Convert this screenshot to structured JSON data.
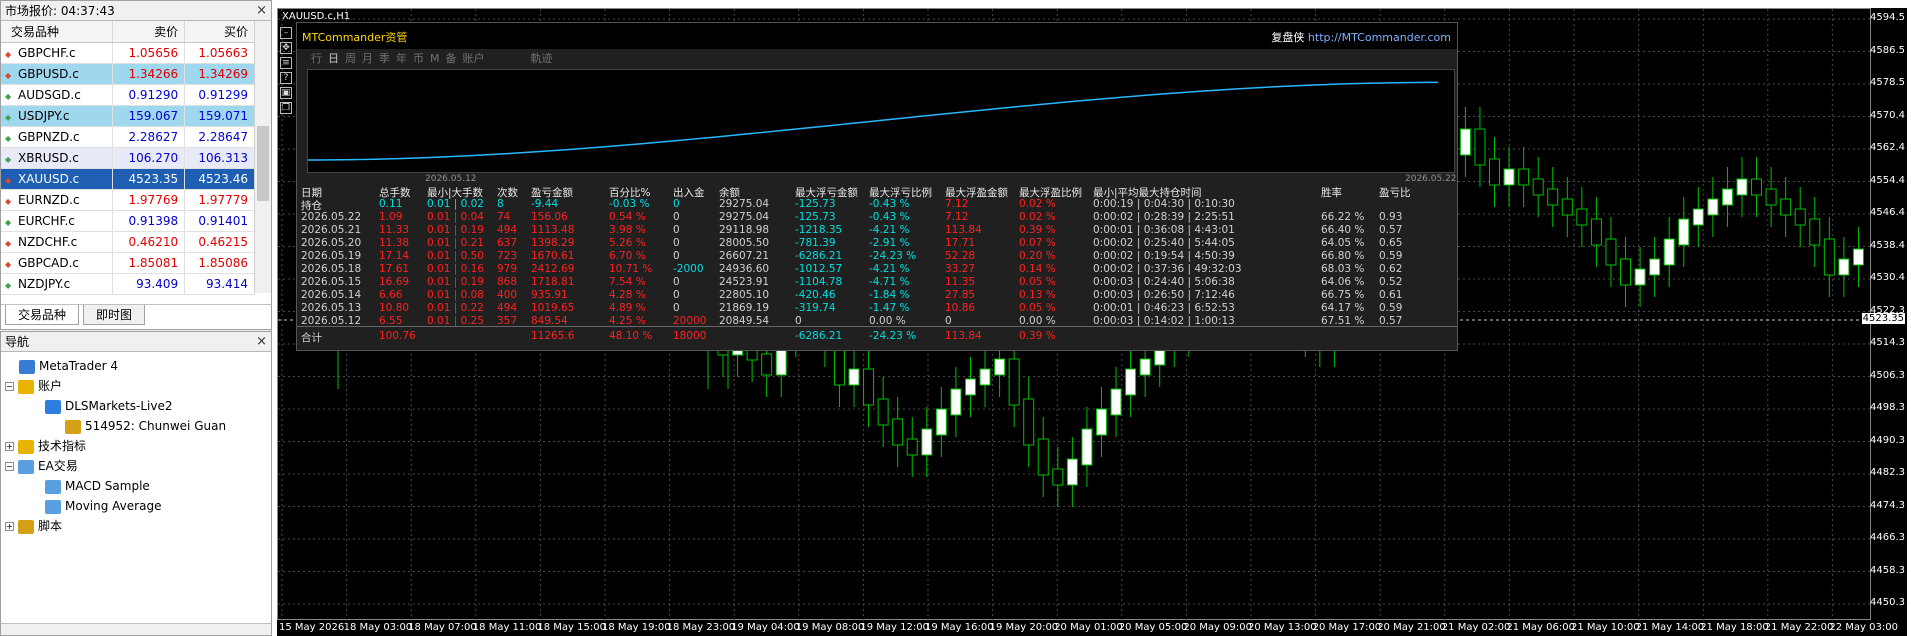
{
  "market_watch": {
    "title": "市场报价: 04:37:43",
    "close": "×",
    "col_symbol": "交易品种",
    "col_bid": "卖价",
    "col_ask": "买价",
    "rows": [
      {
        "symbol": "GBPCHF.c",
        "bid": "1.05656",
        "ask": "1.05663",
        "dir": "down",
        "color": "red"
      },
      {
        "symbol": "GBPUSD.c",
        "bid": "1.34266",
        "ask": "1.34269",
        "dir": "down",
        "color": "red"
      },
      {
        "symbol": "AUDSGD.c",
        "bid": "0.91290",
        "ask": "0.91299",
        "dir": "up",
        "color": "blue"
      },
      {
        "symbol": "USDJPY.c",
        "bid": "159.067",
        "ask": "159.071",
        "dir": "up",
        "color": "blue"
      },
      {
        "symbol": "GBPNZD.c",
        "bid": "2.28627",
        "ask": "2.28647",
        "dir": "up",
        "color": "blue"
      },
      {
        "symbol": "XBRUSD.c",
        "bid": "106.270",
        "ask": "106.313",
        "dir": "up",
        "color": "blue"
      },
      {
        "symbol": "XAUUSD.c",
        "bid": "4523.35",
        "ask": "4523.46",
        "dir": "down",
        "color": "white"
      },
      {
        "symbol": "EURNZD.c",
        "bid": "1.97769",
        "ask": "1.97779",
        "dir": "down",
        "color": "red"
      },
      {
        "symbol": "EURCHF.c",
        "bid": "0.91398",
        "ask": "0.91401",
        "dir": "up",
        "color": "blue"
      },
      {
        "symbol": "NZDCHF.c",
        "bid": "0.46210",
        "ask": "0.46215",
        "dir": "down",
        "color": "red"
      },
      {
        "symbol": "GBPCAD.c",
        "bid": "1.85081",
        "ask": "1.85086",
        "dir": "down",
        "color": "red"
      },
      {
        "symbol": "NZDJPY.c",
        "bid": "93.409",
        "ask": "93.414",
        "dir": "up",
        "color": "blue"
      }
    ],
    "tabs": [
      "交易品种",
      "即时图"
    ]
  },
  "navigator": {
    "title": "导航",
    "close": "×",
    "items": [
      {
        "label": "MetaTrader 4",
        "icon": "terminal-icon",
        "level": 0
      },
      {
        "label": "账户",
        "icon": "accounts-icon",
        "level": 1
      },
      {
        "label": "DLSMarkets-Live2",
        "icon": "server-icon",
        "level": 2
      },
      {
        "label": "514952: Chunwei Guan",
        "icon": "user-icon",
        "level": 3
      },
      {
        "label": "技术指标",
        "icon": "indicator-icon",
        "level": 1
      },
      {
        "label": "EA交易",
        "icon": "expert-icon",
        "level": 1
      },
      {
        "label": "MACD Sample",
        "icon": "expert-icon",
        "level": 2
      },
      {
        "label": "Moving Average",
        "icon": "expert-icon",
        "level": 2
      },
      {
        "label": "脚本",
        "icon": "script-icon",
        "level": 1
      }
    ]
  },
  "chart": {
    "title": "XAUUSD.c,H1",
    "price_labels": [
      "4594.5",
      "4586.5",
      "4578.5",
      "4570.4",
      "4562.4",
      "4554.4",
      "4546.4",
      "4538.4",
      "4530.4",
      "4522.3",
      "4514.3",
      "4506.3",
      "4498.3",
      "4490.3",
      "4482.3",
      "4474.3",
      "4466.3",
      "4458.3",
      "4450.3"
    ],
    "current_price": "4523.35",
    "time_labels": [
      "15 May 2026",
      "18 May 03:00",
      "18 May 07:00",
      "18 May 11:00",
      "18 May 15:00",
      "18 May 19:00",
      "18 May 23:00",
      "19 May 04:00",
      "19 May 08:00",
      "19 May 12:00",
      "19 May 16:00",
      "19 May 20:00",
      "20 May 01:00",
      "20 May 05:00",
      "20 May 09:00",
      "20 May 13:00",
      "20 May 17:00",
      "20 May 21:00",
      "21 May 02:00",
      "21 May 06:00",
      "21 May 10:00",
      "21 May 14:00",
      "21 May 18:00",
      "21 May 22:00",
      "22 May 03:00"
    ],
    "colors": {
      "bull": "#ffffff",
      "bear": "#000000",
      "wick": "#00cc00",
      "bg": "#000000",
      "grid": "#555555"
    }
  },
  "overlay": {
    "brand": "MTCommander资管",
    "link_cn": "复盘侠",
    "link_url": "http://MTCommander.com",
    "tabs": [
      "行",
      "日",
      "周",
      "月",
      "季",
      "年",
      "币",
      "M",
      "备",
      "账户",
      "",
      "軌迹"
    ],
    "curve_start": "2026.05.12",
    "curve_end": "2026.05.22",
    "headers": [
      "日期",
      "总手数",
      "最小|大手数",
      "次数",
      "盈亏金额",
      "百分比%",
      "出入金",
      "余额",
      "最大浮亏金额",
      "最大浮亏比例",
      "最大浮盈金额",
      "最大浮盈比例",
      "最小|平均最大持仓时间",
      "胜率",
      "盈亏比"
    ],
    "position_row": [
      "持仓",
      "0.11",
      "0.01 | 0.02",
      "8",
      "-9.44",
      "-0.03 %",
      "0",
      "29275.04",
      "-125.73",
      "-0.43 %",
      "7.12",
      "0.02 %",
      "0:00:19 | 0:04:30 | 0:10:30",
      "",
      ""
    ],
    "rows": [
      [
        "2026.05.22",
        "1.09",
        "0.01 | 0.04",
        "74",
        "156.06",
        "0.54 %",
        "0",
        "29275.04",
        "-125.73",
        "-0.43 %",
        "7.12",
        "0.02 %",
        "0:00:02 | 0:28:39 | 2:25:51",
        "66.22 %",
        "0.93"
      ],
      [
        "2026.05.21",
        "11.33",
        "0.01 | 0.19",
        "494",
        "1113.48",
        "3.98 %",
        "0",
        "29118.98",
        "-1218.35",
        "-4.21 %",
        "113.84",
        "0.39 %",
        "0:00:01 | 0:36:08 | 4:43:01",
        "66.40 %",
        "0.57"
      ],
      [
        "2026.05.20",
        "11.38",
        "0.01 | 0.21",
        "637",
        "1398.29",
        "5.26 %",
        "0",
        "28005.50",
        "-781.39",
        "-2.91 %",
        "17.71",
        "0.07 %",
        "0:00:02 | 0:25:40 | 5:44:05",
        "64.05 %",
        "0.65"
      ],
      [
        "2026.05.19",
        "17.14",
        "0.01 | 0.50",
        "723",
        "1670.61",
        "6.70 %",
        "0",
        "26607.21",
        "-6286.21",
        "-24.23 %",
        "52.28",
        "0.20 %",
        "0:00:02 | 0:19:54 | 4:50:39",
        "66.80 %",
        "0.59"
      ],
      [
        "2026.05.18",
        "17.61",
        "0.01 | 0.16",
        "979",
        "2412.69",
        "10.71 %",
        "-2000",
        "24936.60",
        "-1012.57",
        "-4.21 %",
        "33.27",
        "0.14 %",
        "0:00:02 | 0:37:36 | 49:32:03",
        "68.03 %",
        "0.62"
      ],
      [
        "2026.05.15",
        "16.69",
        "0.01 | 0.19",
        "868",
        "1718.81",
        "7.54 %",
        "0",
        "24523.91",
        "-1104.78",
        "-4.71 %",
        "11.35",
        "0.05 %",
        "0:00:03 | 0:24:40 | 5:06:38",
        "64.06 %",
        "0.52"
      ],
      [
        "2026.05.14",
        "6.66",
        "0.01 | 0.08",
        "400",
        "935.91",
        "4.28 %",
        "0",
        "22805.10",
        "-420.46",
        "-1.84 %",
        "27.85",
        "0.13 %",
        "0:00:03 | 0:26:50 | 7:12:46",
        "66.75 %",
        "0.61"
      ],
      [
        "2026.05.13",
        "10.80",
        "0.01 | 0.22",
        "494",
        "1019.65",
        "4.89 %",
        "0",
        "21869.19",
        "-319.74",
        "-1.47 %",
        "10.86",
        "0.05 %",
        "0:00:01 | 0:46:23 | 6:52:53",
        "64.17 %",
        "0.59"
      ],
      [
        "2026.05.12",
        "6.55",
        "0.01 | 0.25",
        "357",
        "849.54",
        "4.25 %",
        "20000",
        "20849.54",
        "0",
        "0.00 %",
        "0",
        "0.00 %",
        "0:00:03 | 0:14:02 | 1:00:13",
        "67.51 %",
        "0.57"
      ]
    ],
    "total_row": [
      "合计",
      "100.76",
      "",
      "",
      "11265.6",
      "48.10 %",
      "18000",
      "",
      "-6286.21",
      "-24.23 %",
      "113.84",
      "0.39 %",
      "",
      "",
      ""
    ]
  }
}
